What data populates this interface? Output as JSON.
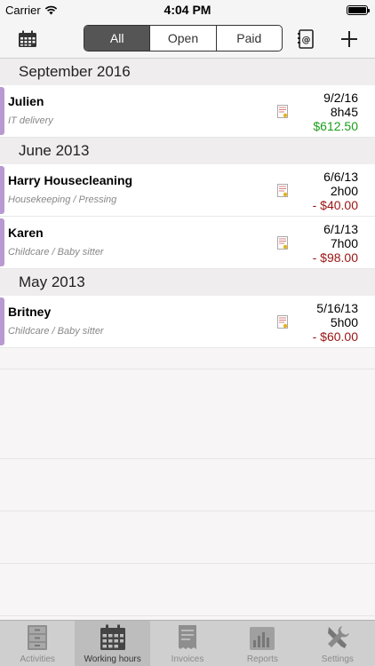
{
  "status": {
    "carrier": "Carrier",
    "time": "4:04 PM"
  },
  "nav": {
    "segments": [
      "All",
      "Open",
      "Paid"
    ],
    "selected_segment": "All"
  },
  "sections": [
    {
      "title": "September 2016",
      "rows": [
        {
          "name": "Julien",
          "category": "IT delivery",
          "date": "9/2/16",
          "duration": "8h45",
          "amount": "$612.50"
        }
      ]
    },
    {
      "title": "June 2013",
      "rows": [
        {
          "name": "Harry Housecleaning",
          "category": "Housekeeping / Pressing",
          "date": "6/6/13",
          "duration": "2h00",
          "amount": "- $40.00"
        },
        {
          "name": "Karen",
          "category": "Childcare / Baby sitter",
          "date": "6/1/13",
          "duration": "7h00",
          "amount": "- $98.00"
        }
      ]
    },
    {
      "title": "May 2013",
      "rows": [
        {
          "name": "Britney",
          "category": "Childcare / Baby sitter",
          "date": "5/16/13",
          "duration": "5h00",
          "amount": "- $60.00"
        }
      ]
    }
  ],
  "tabs": [
    {
      "label": "Activities",
      "icon": "cabinet-icon"
    },
    {
      "label": "Working hours",
      "icon": "calendar-icon"
    },
    {
      "label": "Invoices",
      "icon": "invoice-icon"
    },
    {
      "label": "Reports",
      "icon": "bar-chart-icon"
    },
    {
      "label": "Settings",
      "icon": "tools-icon"
    }
  ],
  "selected_tab": "Working hours",
  "colors": {
    "accent_bar": "#b79ad0",
    "positive": "#1a9e1a",
    "negative": "#9b1414"
  }
}
